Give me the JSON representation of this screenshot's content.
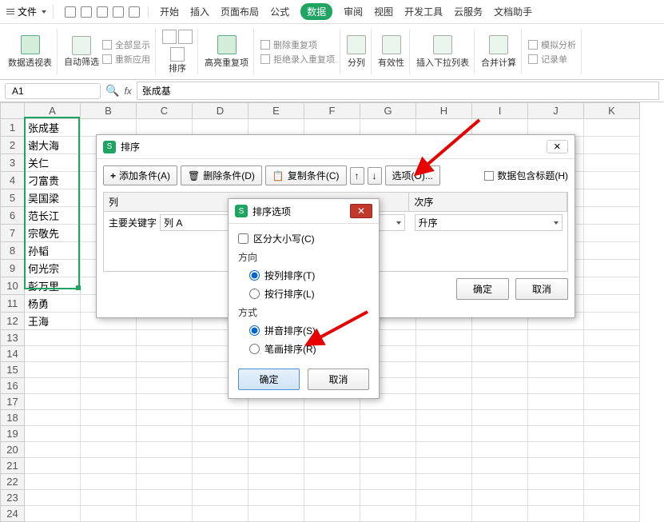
{
  "menu": {
    "file": "文件",
    "items": [
      "开始",
      "插入",
      "页面布局",
      "公式",
      "数据",
      "审阅",
      "视图",
      "开发工具",
      "云服务",
      "文档助手"
    ],
    "active": "数据"
  },
  "ribbon": {
    "pivot": "数据透视表",
    "filter": "自动筛选",
    "showAll": "全部显示",
    "reapply": "重新应用",
    "sort": "排序",
    "highlight": "高亮重复项",
    "delDup": "删除重复项",
    "rejectDup": "拒绝录入重复项",
    "textToCol": "分列",
    "validity": "有效性",
    "insertDropdown": "插入下拉列表",
    "consolidate": "合并计算",
    "whatif": "模拟分析",
    "recordForm": "记录单"
  },
  "formula": {
    "cellRef": "A1",
    "fx": "fx",
    "value": "张成基"
  },
  "cols": [
    "A",
    "B",
    "C",
    "D",
    "E",
    "F",
    "G",
    "H",
    "I",
    "J",
    "K"
  ],
  "rows": [
    1,
    2,
    3,
    4,
    5,
    6,
    7,
    8,
    9,
    10,
    11,
    12,
    13,
    14,
    15,
    16,
    17,
    18,
    19,
    20,
    21,
    22,
    23,
    24
  ],
  "cells": {
    "A": [
      "张成基",
      "谢大海",
      "关仁",
      "刁富贵",
      "吴国梁",
      "范长江",
      "宗敬先",
      "孙韬",
      "何光宗",
      "彭万里",
      "杨勇",
      "王海"
    ]
  },
  "sortDialog": {
    "title": "排序",
    "addCond": "添加条件(A)",
    "delCond": "删除条件(D)",
    "copyCond": "复制条件(C)",
    "options": "选项(O)...",
    "hasHeader": "数据包含标题(H)",
    "colHeader": "列",
    "orderHeader": "次序",
    "mainKey": "主要关键字",
    "colA": "列 A",
    "asc": "升序",
    "ok": "确定",
    "cancel": "取消"
  },
  "optDialog": {
    "title": "排序选项",
    "caseSensitive": "区分大小写(C)",
    "direction": "方向",
    "byCol": "按列排序(T)",
    "byRow": "按行排序(L)",
    "method": "方式",
    "pinyin": "拼音排序(S)",
    "stroke": "笔画排序(R)",
    "ok": "确定",
    "cancel": "取消"
  }
}
